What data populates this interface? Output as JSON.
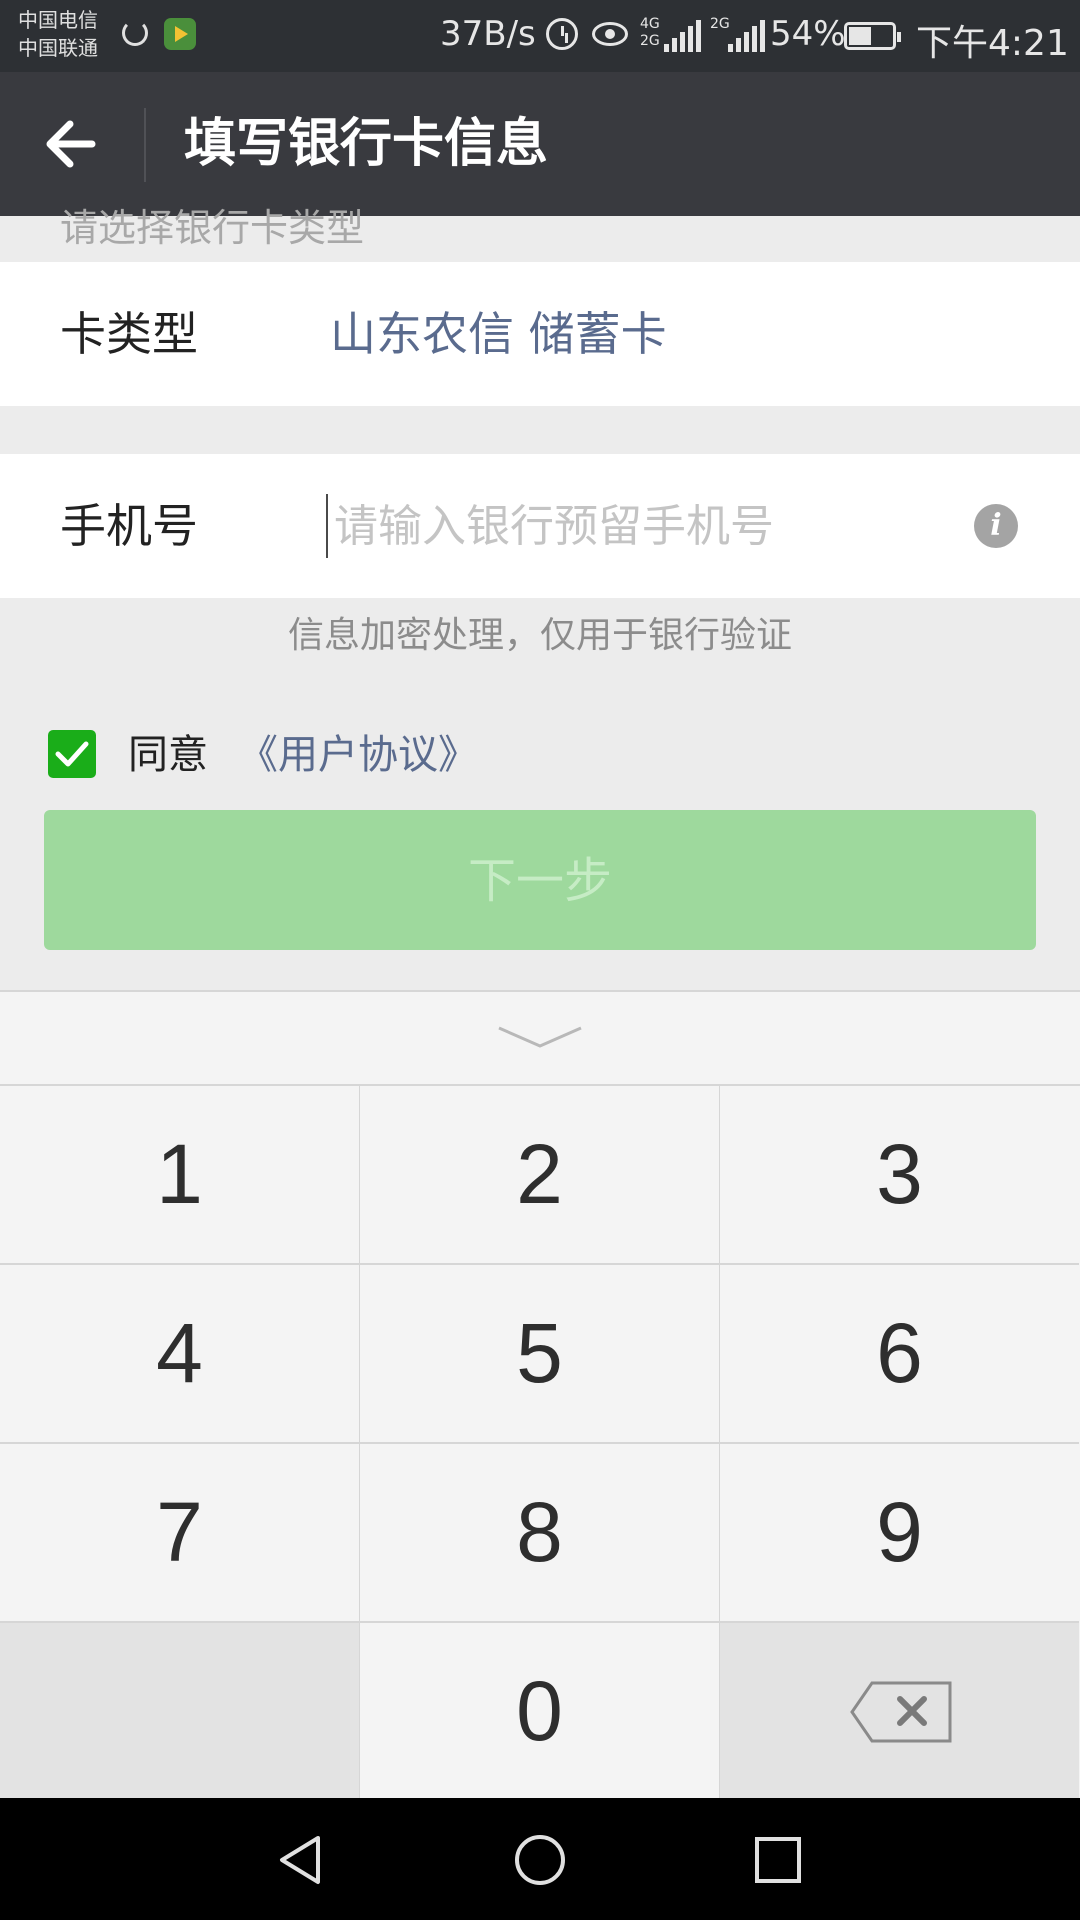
{
  "status_bar": {
    "carrier_1": "中国电信",
    "carrier_2": "中国联通",
    "net_speed": "37B/s",
    "net_type_1": "4G",
    "net_type_2": "2G",
    "net_type_3": "2G",
    "battery": "54%",
    "time": "下午4:21"
  },
  "header": {
    "title": "填写银行卡信息",
    "back_icon": "arrow-left-icon"
  },
  "form": {
    "faded_hint": "请选择银行卡类型",
    "card_type_label": "卡类型",
    "card_type_value": "山东农信 储蓄卡",
    "phone_label": "手机号",
    "phone_placeholder": "请输入银行预留手机号",
    "phone_value": "",
    "info_icon": "i",
    "note": "信息加密处理，仅用于银行验证",
    "agree_label": "同意",
    "agreement_link": "《用户协议》",
    "agree_checked": true,
    "next_button": "下一步"
  },
  "keyboard": {
    "keys": [
      "1",
      "2",
      "3",
      "4",
      "5",
      "6",
      "7",
      "8",
      "9",
      "",
      "0",
      ""
    ],
    "collapse_icon": "chevron-down-icon",
    "delete_icon": "backspace-icon"
  },
  "nav_bar": {
    "back": "triangle-back-icon",
    "home": "circle-home-icon",
    "recents": "square-recents-icon"
  },
  "colors": {
    "title_bar": "#393a3f",
    "status_bar": "#2d3034",
    "accent_green": "#1aad19",
    "button_disabled": "#9ed99d",
    "link": "#5a6b8e"
  }
}
